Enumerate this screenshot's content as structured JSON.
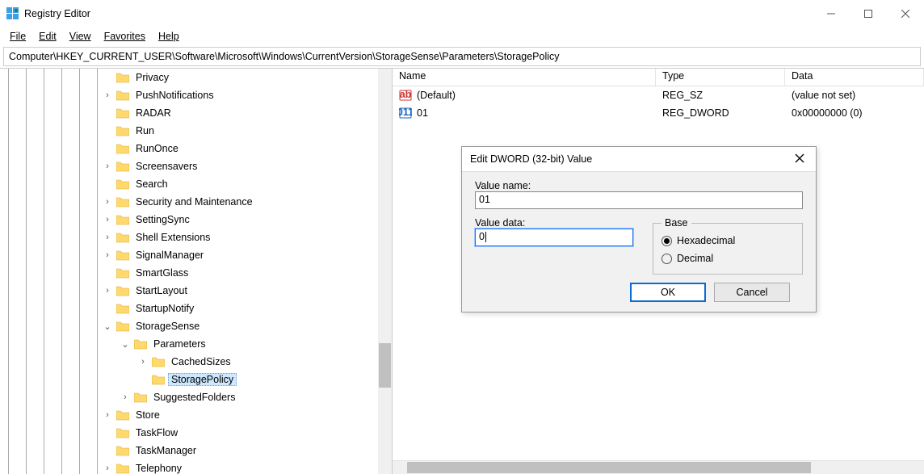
{
  "window": {
    "title": "Registry Editor"
  },
  "menus": {
    "file": "File",
    "edit": "Edit",
    "view": "View",
    "favorites": "Favorites",
    "help": "Help"
  },
  "address": "Computer\\HKEY_CURRENT_USER\\Software\\Microsoft\\Windows\\CurrentVersion\\StorageSense\\Parameters\\StoragePolicy",
  "tree": [
    {
      "indent": 0,
      "twisty": "",
      "label": "Privacy"
    },
    {
      "indent": 0,
      "twisty": ">",
      "label": "PushNotifications"
    },
    {
      "indent": 0,
      "twisty": "",
      "label": "RADAR"
    },
    {
      "indent": 0,
      "twisty": "",
      "label": "Run"
    },
    {
      "indent": 0,
      "twisty": "",
      "label": "RunOnce"
    },
    {
      "indent": 0,
      "twisty": ">",
      "label": "Screensavers"
    },
    {
      "indent": 0,
      "twisty": "",
      "label": "Search"
    },
    {
      "indent": 0,
      "twisty": ">",
      "label": "Security and Maintenance"
    },
    {
      "indent": 0,
      "twisty": ">",
      "label": "SettingSync"
    },
    {
      "indent": 0,
      "twisty": ">",
      "label": "Shell Extensions"
    },
    {
      "indent": 0,
      "twisty": ">",
      "label": "SignalManager"
    },
    {
      "indent": 0,
      "twisty": "",
      "label": "SmartGlass"
    },
    {
      "indent": 0,
      "twisty": ">",
      "label": "StartLayout"
    },
    {
      "indent": 0,
      "twisty": "",
      "label": "StartupNotify"
    },
    {
      "indent": 0,
      "twisty": "v",
      "label": "StorageSense"
    },
    {
      "indent": 1,
      "twisty": "v",
      "label": "Parameters"
    },
    {
      "indent": 2,
      "twisty": ">",
      "label": "CachedSizes"
    },
    {
      "indent": 2,
      "twisty": "",
      "label": "StoragePolicy",
      "selected": true
    },
    {
      "indent": 1,
      "twisty": ">",
      "label": "SuggestedFolders"
    },
    {
      "indent": 0,
      "twisty": ">",
      "label": "Store"
    },
    {
      "indent": 0,
      "twisty": "",
      "label": "TaskFlow"
    },
    {
      "indent": 0,
      "twisty": "",
      "label": "TaskManager"
    },
    {
      "indent": 0,
      "twisty": ">",
      "label": "Telephony"
    }
  ],
  "list": {
    "headers": {
      "name": "Name",
      "type": "Type",
      "data": "Data"
    },
    "rows": [
      {
        "icon": "sz",
        "name": "(Default)",
        "type": "REG_SZ",
        "data": "(value not set)"
      },
      {
        "icon": "dword",
        "name": "01",
        "type": "REG_DWORD",
        "data": "0x00000000 (0)"
      }
    ]
  },
  "dialog": {
    "title": "Edit DWORD (32-bit) Value",
    "valuename_label": "Value name:",
    "valuename": "01",
    "valuedata_label": "Value data:",
    "valuedata": "0",
    "base_label": "Base",
    "hex": "Hexadecimal",
    "dec": "Decimal",
    "base_selected": "hex",
    "ok": "OK",
    "cancel": "Cancel"
  }
}
